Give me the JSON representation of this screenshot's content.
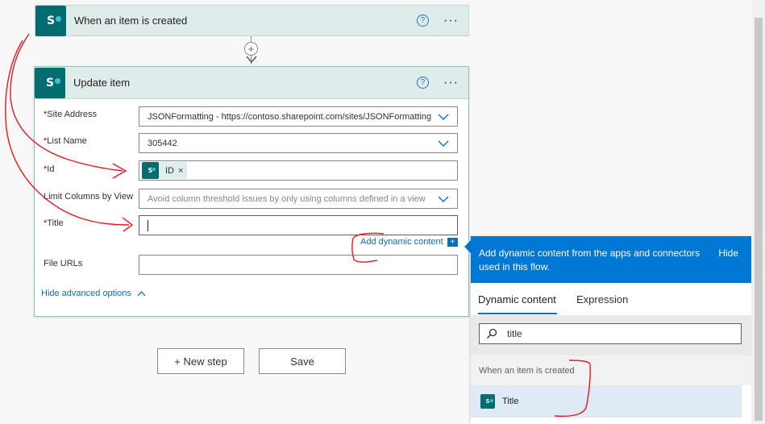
{
  "trigger": {
    "title": "When an item is created",
    "icon": "sharepoint-icon",
    "help_icon": "?",
    "more_icon": "···"
  },
  "connector": {
    "add_icon": "+"
  },
  "action": {
    "title": "Update item",
    "icon": "sharepoint-icon",
    "help_icon": "?",
    "more_icon": "···",
    "fields": {
      "site_address": {
        "label": "Site Address",
        "required": "*",
        "value": "JSONFormatting - https://contoso.sharepoint.com/sites/JSONFormatting"
      },
      "list_name": {
        "label": "List Name",
        "required": "*",
        "value": "305442"
      },
      "id": {
        "label": "Id",
        "required": "*",
        "token_label": "ID",
        "token_close": "×"
      },
      "limit_columns": {
        "label": "Limit Columns by View",
        "placeholder": "Avoid column threshold issues by only using columns defined in a view"
      },
      "title": {
        "label": "Title",
        "required": "*",
        "value": ""
      },
      "file_urls": {
        "label": "File URLs",
        "value": ""
      }
    },
    "add_dynamic_content": "Add dynamic content",
    "add_dynamic_badge": "+",
    "hide_advanced": "Hide advanced options"
  },
  "buttons": {
    "new_step": "+ New step",
    "save": "Save"
  },
  "dynamic_panel": {
    "header_text": "Add dynamic content from the apps and connectors used in this flow.",
    "hide": "Hide",
    "tabs": [
      "Dynamic content",
      "Expression"
    ],
    "active_tab": "Dynamic content",
    "search_value": "title",
    "group_label": "When an item is created",
    "items": [
      {
        "label": "Title",
        "icon": "sharepoint-icon"
      }
    ]
  },
  "colors": {
    "accent": "#0078d4",
    "sharepoint": "#036c70",
    "card_header": "#deecea",
    "annotation": "#e8191f"
  }
}
